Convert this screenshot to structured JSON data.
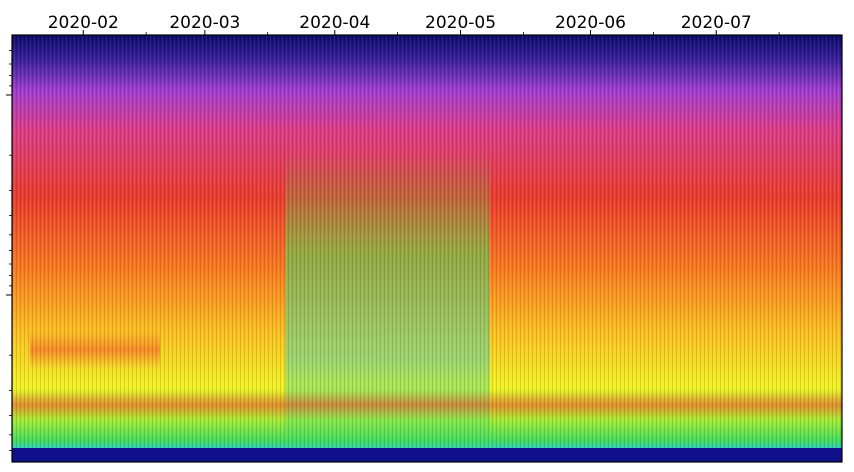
{
  "chart_data": {
    "type": "heatmap",
    "title": "",
    "xlabel": "",
    "ylabel": "",
    "x_axis": {
      "position": "top",
      "tick_labels": [
        "2020-02",
        "2020-03",
        "2020-04",
        "2020-05",
        "2020-06",
        "2020-07"
      ],
      "range": [
        "2020-01-15",
        "2020-07-31"
      ]
    },
    "y_axis": {
      "scale": "log",
      "tick_labels": []
    },
    "colormap": [
      "#0a0a6e",
      "#3b1fa3",
      "#a43bd6",
      "#e23a8a",
      "#f23a2a",
      "#ff7a1a",
      "#ffc21a",
      "#f4f21a",
      "#a6ee2a",
      "#3fe05a",
      "#2ad1c8",
      "#10108a"
    ],
    "features": [
      {
        "name": "low-frequency band",
        "strength": "high"
      },
      {
        "name": "broadband event",
        "start": "2020-03-28",
        "end": "2020-05-05"
      }
    ]
  }
}
